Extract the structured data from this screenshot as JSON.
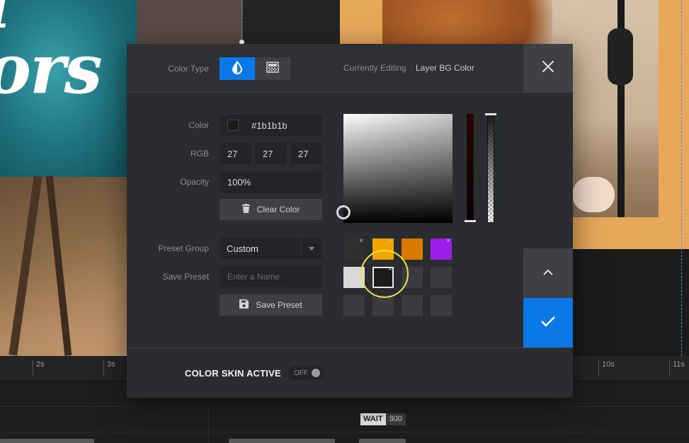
{
  "background": {
    "canvas_text": "l\nors",
    "ruler_ticks": [
      {
        "label": "2s"
      },
      {
        "label": "3s"
      },
      {
        "label": "10s"
      },
      {
        "label": "11s"
      }
    ],
    "wait_tags": [
      {
        "label": "WAIT",
        "value": "300"
      }
    ]
  },
  "modal": {
    "header": {
      "color_type_label": "Color Type",
      "currently_editing_label": "Currently Editing",
      "currently_editing_value": "Layer BG Color",
      "solid_icon": "droplet-icon",
      "gradient_icon": "gradient-icon",
      "close_icon": "close-icon"
    },
    "fields": {
      "color_label": "Color",
      "color_value": "#1b1b1b",
      "rgb_label": "RGB",
      "r": "27",
      "g": "27",
      "b": "27",
      "opacity_label": "Opacity",
      "opacity_value": "100%",
      "clear_button": "Clear Color",
      "preset_group_label": "Preset Group",
      "preset_group_value": "Custom",
      "save_preset_label": "Save Preset",
      "name_placeholder": "Enter a Name",
      "save_preset_button": "Save Preset"
    },
    "presets": [
      {
        "color": "#2f2f2f",
        "removable": true
      },
      {
        "color": "#f0a500",
        "removable": true
      },
      {
        "color": "#d97a00",
        "removable": false
      },
      {
        "color": "#9b1fe8",
        "removable": true
      },
      {
        "color": "#d9d9d9",
        "removable": true
      },
      {
        "color": "#1b1b1b",
        "removable": true,
        "selected": true
      },
      {
        "color": "#3a3b3f"
      },
      {
        "color": "#3a3b3f"
      },
      {
        "color": "#3a3b3f"
      },
      {
        "color": "#3a3b3f"
      },
      {
        "color": "#3a3b3f"
      },
      {
        "color": "#3a3b3f"
      }
    ],
    "footer": {
      "color_skin_label": "COLOR SKIN ACTIVE",
      "toggle_state": "OFF"
    },
    "accent": "#0a78e6"
  }
}
